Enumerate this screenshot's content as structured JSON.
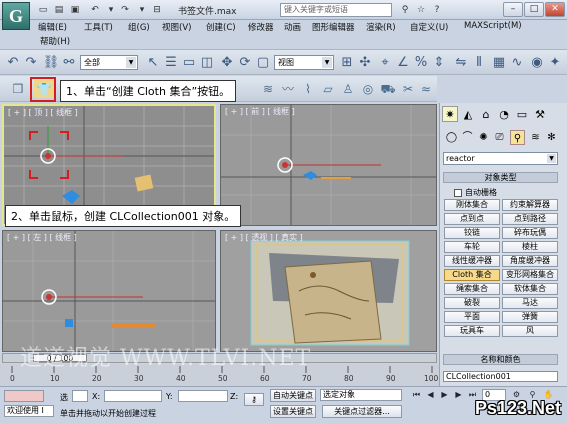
{
  "title": {
    "doc": "书签文件.max",
    "search_placeholder": "键入关键字或短语"
  },
  "menu": [
    "编辑(E)",
    "工具(T)",
    "组(G)",
    "视图(V)",
    "创建(C)",
    "修改器",
    "动画",
    "图形编辑器",
    "渲染(R)",
    "自定义(U)",
    "MAXScript(M)"
  ],
  "menu2": [
    "帮助(H)"
  ],
  "toolbar": {
    "selection_filter": "全部",
    "ref_coord": "视图"
  },
  "callouts": {
    "step1": "1、单击“创建 Cloth 集合”按钮。",
    "step2": "2、单击鼠标，创建 CLCollection001 对象。"
  },
  "viewports": {
    "top": "[ + ] [ 顶 ] [ 线框 ]",
    "front": "[ + ] [ 前 ] [ 线框 ]",
    "left": "[ + ] [ 左 ] [ 线框 ]",
    "persp": "[ + ] [ 透视 ] [ 真实 ]"
  },
  "panel": {
    "category": "reactor",
    "object_type_header": "对象类型",
    "auto_stack_label": "自动栅格",
    "buttons": [
      [
        "刚体集合",
        "约束解算器"
      ],
      [
        "点到点",
        "点到路径"
      ],
      [
        "铰链",
        "碎布玩偶"
      ],
      [
        "车轮",
        "棱柱"
      ],
      [
        "线性缓冲器",
        "角度缓冲器"
      ],
      [
        "Cloth 集合",
        "变形网格集合"
      ],
      [
        "绳索集合",
        "软体集合"
      ],
      [
        "破裂",
        "马达"
      ],
      [
        "平面",
        "弹簧"
      ],
      [
        "玩具车",
        "风"
      ]
    ],
    "active_button": "Cloth 集合",
    "name_color_header": "名称和颜色",
    "object_name": "CLCollection001"
  },
  "timeline": {
    "position": "0 / 100",
    "ticks": [
      "0",
      "10",
      "20",
      "30",
      "40",
      "50",
      "60",
      "70",
      "80",
      "90",
      "100"
    ]
  },
  "status": {
    "select_label": "选",
    "x_label": "X:",
    "y_label": "Y:",
    "z_label": "Z:",
    "autokey": "自动关键点",
    "selected_objects": "选定对象",
    "set_key": "设置关键点",
    "key_filters": "关键点过滤器...",
    "welcome": "欢迎使用 I",
    "prompt": "单击并拖动以开始创建过程",
    "frame": "0"
  },
  "watermark": "道道视觉 WWW.TLVI.NET",
  "logo": "Ps123.Net",
  "colors": {
    "active_viewport_border": "#e6e68a",
    "highlight_red": "#d21e1e",
    "active_button": "#f6d98a"
  }
}
